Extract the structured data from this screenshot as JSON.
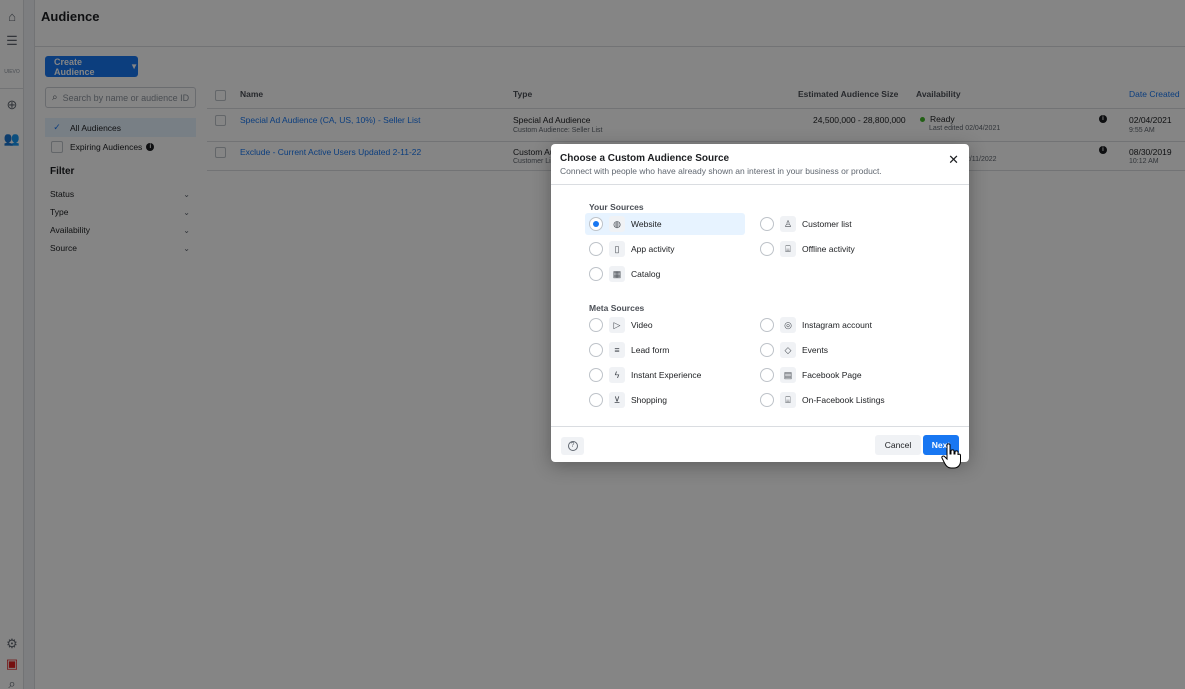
{
  "page": {
    "title": "Audience"
  },
  "rail": {
    "label": "UIEVO"
  },
  "toolbar": {
    "create_label": "Create Audience"
  },
  "search": {
    "placeholder": "Search by name or audience ID"
  },
  "audience_lists": [
    {
      "label": "All Audiences",
      "selected": true
    },
    {
      "label": "Expiring Audiences",
      "selected": false
    }
  ],
  "filter": {
    "title": "Filter",
    "items": [
      "Status",
      "Type",
      "Availability",
      "Source"
    ]
  },
  "table": {
    "headers": {
      "name": "Name",
      "type": "Type",
      "size": "Estimated Audience Size",
      "availability": "Availability",
      "date": "Date Created"
    },
    "rows": [
      {
        "name": "Special Ad Audience (CA, US, 10%) - Seller List",
        "type": "Special Ad Audience",
        "type_sub": "Custom Audience: Seller List",
        "size": "24,500,000 - 28,800,000",
        "availability": "Ready",
        "availability_sub": "Last edited 02/04/2021",
        "date": "02/04/2021",
        "time": "9:55 AM"
      },
      {
        "name": "Exclude - Current Active Users Updated 2-11-22",
        "type": "Custom Audience",
        "type_sub": "Customer List",
        "size": "",
        "availability": "",
        "availability_sub": "02/11/2022",
        "date": "08/30/2019",
        "time": "10:12 AM"
      }
    ]
  },
  "modal": {
    "title": "Choose a Custom Audience Source",
    "subtitle": "Connect with people who have already shown an interest in your business or product.",
    "your_sources_label": "Your Sources",
    "your_sources": [
      {
        "label": "Website",
        "icon": "globe-icon",
        "selected": true
      },
      {
        "label": "Customer list",
        "icon": "person-icon",
        "selected": false
      },
      {
        "label": "App activity",
        "icon": "phone-icon",
        "selected": false
      },
      {
        "label": "Offline activity",
        "icon": "store-icon",
        "selected": false
      },
      {
        "label": "Catalog",
        "icon": "grid-icon",
        "selected": false
      }
    ],
    "meta_sources_label": "Meta Sources",
    "meta_sources": [
      {
        "label": "Video",
        "icon": "play-icon"
      },
      {
        "label": "Instagram account",
        "icon": "instagram-icon"
      },
      {
        "label": "Lead form",
        "icon": "list-icon"
      },
      {
        "label": "Events",
        "icon": "tag-icon"
      },
      {
        "label": "Instant Experience",
        "icon": "bolt-icon"
      },
      {
        "label": "Facebook Page",
        "icon": "page-icon"
      },
      {
        "label": "Shopping",
        "icon": "cart-icon"
      },
      {
        "label": "On-Facebook Listings",
        "icon": "shop-icon"
      }
    ],
    "cancel_label": "Cancel",
    "next_label": "Next"
  }
}
